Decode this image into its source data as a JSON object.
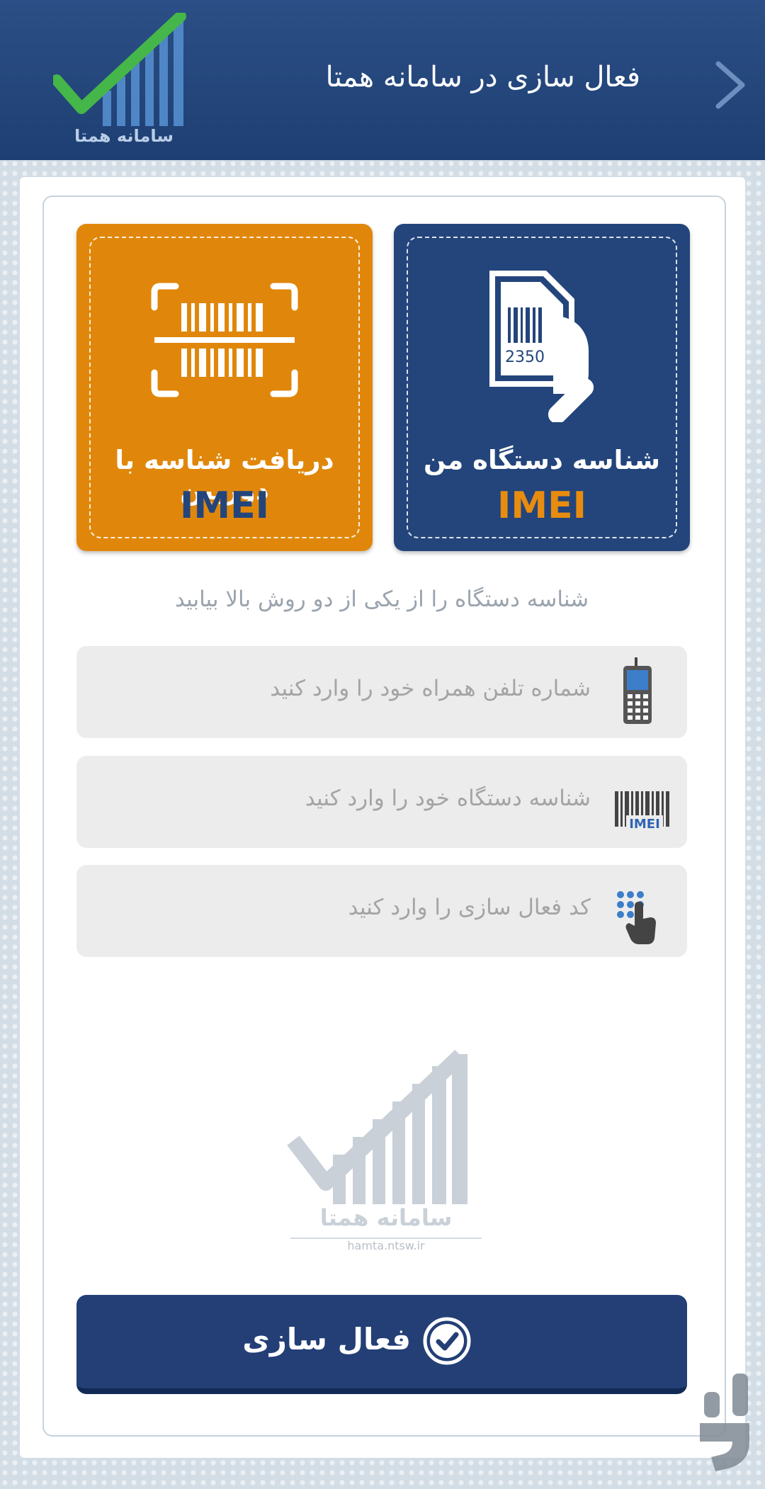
{
  "header": {
    "title": "فعال سازی در سامانه همتا",
    "logo_text": "سامانه همتا"
  },
  "tiles": {
    "my_device": {
      "label": "شناسه دستگاه من",
      "imei": "IMEI",
      "card_number": "2350"
    },
    "camera": {
      "label": "دریافت شناسه با دوربین",
      "imei": "IMEI"
    }
  },
  "hint": "شناسه دستگاه را از یکی از دو روش بالا بیابید",
  "fields": {
    "phone": {
      "placeholder": "شماره تلفن همراه خود را وارد کنید",
      "icon": "mobile-phone-icon"
    },
    "imei": {
      "placeholder": "شناسه دستگاه خود را وارد کنید",
      "icon": "imei-barcode-icon",
      "icon_text": "IMEI"
    },
    "code": {
      "placeholder": "کد فعال سازی را وارد کنید",
      "icon": "keypad-hand-icon"
    }
  },
  "watermark": {
    "logo_text": "سامانه همتا",
    "url": "hamta.ntsw.ir"
  },
  "activate_button": {
    "label": "فعال سازی"
  },
  "colors": {
    "header": "#23457b",
    "accent_orange": "#e0870b",
    "check_green": "#3fae3a"
  }
}
